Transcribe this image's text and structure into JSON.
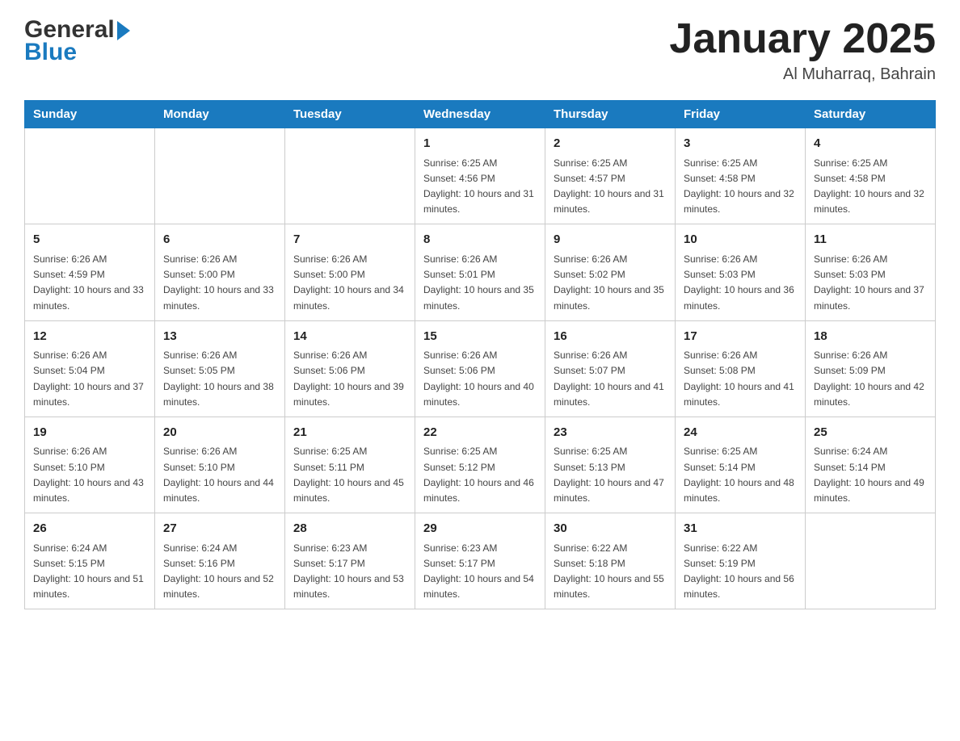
{
  "header": {
    "logo_general": "General",
    "logo_blue": "Blue",
    "month_title": "January 2025",
    "subtitle": "Al Muharraq, Bahrain"
  },
  "weekdays": [
    "Sunday",
    "Monday",
    "Tuesday",
    "Wednesday",
    "Thursday",
    "Friday",
    "Saturday"
  ],
  "weeks": [
    [
      {
        "day": "",
        "sunrise": "",
        "sunset": "",
        "daylight": ""
      },
      {
        "day": "",
        "sunrise": "",
        "sunset": "",
        "daylight": ""
      },
      {
        "day": "",
        "sunrise": "",
        "sunset": "",
        "daylight": ""
      },
      {
        "day": "1",
        "sunrise": "Sunrise: 6:25 AM",
        "sunset": "Sunset: 4:56 PM",
        "daylight": "Daylight: 10 hours and 31 minutes."
      },
      {
        "day": "2",
        "sunrise": "Sunrise: 6:25 AM",
        "sunset": "Sunset: 4:57 PM",
        "daylight": "Daylight: 10 hours and 31 minutes."
      },
      {
        "day": "3",
        "sunrise": "Sunrise: 6:25 AM",
        "sunset": "Sunset: 4:58 PM",
        "daylight": "Daylight: 10 hours and 32 minutes."
      },
      {
        "day": "4",
        "sunrise": "Sunrise: 6:25 AM",
        "sunset": "Sunset: 4:58 PM",
        "daylight": "Daylight: 10 hours and 32 minutes."
      }
    ],
    [
      {
        "day": "5",
        "sunrise": "Sunrise: 6:26 AM",
        "sunset": "Sunset: 4:59 PM",
        "daylight": "Daylight: 10 hours and 33 minutes."
      },
      {
        "day": "6",
        "sunrise": "Sunrise: 6:26 AM",
        "sunset": "Sunset: 5:00 PM",
        "daylight": "Daylight: 10 hours and 33 minutes."
      },
      {
        "day": "7",
        "sunrise": "Sunrise: 6:26 AM",
        "sunset": "Sunset: 5:00 PM",
        "daylight": "Daylight: 10 hours and 34 minutes."
      },
      {
        "day": "8",
        "sunrise": "Sunrise: 6:26 AM",
        "sunset": "Sunset: 5:01 PM",
        "daylight": "Daylight: 10 hours and 35 minutes."
      },
      {
        "day": "9",
        "sunrise": "Sunrise: 6:26 AM",
        "sunset": "Sunset: 5:02 PM",
        "daylight": "Daylight: 10 hours and 35 minutes."
      },
      {
        "day": "10",
        "sunrise": "Sunrise: 6:26 AM",
        "sunset": "Sunset: 5:03 PM",
        "daylight": "Daylight: 10 hours and 36 minutes."
      },
      {
        "day": "11",
        "sunrise": "Sunrise: 6:26 AM",
        "sunset": "Sunset: 5:03 PM",
        "daylight": "Daylight: 10 hours and 37 minutes."
      }
    ],
    [
      {
        "day": "12",
        "sunrise": "Sunrise: 6:26 AM",
        "sunset": "Sunset: 5:04 PM",
        "daylight": "Daylight: 10 hours and 37 minutes."
      },
      {
        "day": "13",
        "sunrise": "Sunrise: 6:26 AM",
        "sunset": "Sunset: 5:05 PM",
        "daylight": "Daylight: 10 hours and 38 minutes."
      },
      {
        "day": "14",
        "sunrise": "Sunrise: 6:26 AM",
        "sunset": "Sunset: 5:06 PM",
        "daylight": "Daylight: 10 hours and 39 minutes."
      },
      {
        "day": "15",
        "sunrise": "Sunrise: 6:26 AM",
        "sunset": "Sunset: 5:06 PM",
        "daylight": "Daylight: 10 hours and 40 minutes."
      },
      {
        "day": "16",
        "sunrise": "Sunrise: 6:26 AM",
        "sunset": "Sunset: 5:07 PM",
        "daylight": "Daylight: 10 hours and 41 minutes."
      },
      {
        "day": "17",
        "sunrise": "Sunrise: 6:26 AM",
        "sunset": "Sunset: 5:08 PM",
        "daylight": "Daylight: 10 hours and 41 minutes."
      },
      {
        "day": "18",
        "sunrise": "Sunrise: 6:26 AM",
        "sunset": "Sunset: 5:09 PM",
        "daylight": "Daylight: 10 hours and 42 minutes."
      }
    ],
    [
      {
        "day": "19",
        "sunrise": "Sunrise: 6:26 AM",
        "sunset": "Sunset: 5:10 PM",
        "daylight": "Daylight: 10 hours and 43 minutes."
      },
      {
        "day": "20",
        "sunrise": "Sunrise: 6:26 AM",
        "sunset": "Sunset: 5:10 PM",
        "daylight": "Daylight: 10 hours and 44 minutes."
      },
      {
        "day": "21",
        "sunrise": "Sunrise: 6:25 AM",
        "sunset": "Sunset: 5:11 PM",
        "daylight": "Daylight: 10 hours and 45 minutes."
      },
      {
        "day": "22",
        "sunrise": "Sunrise: 6:25 AM",
        "sunset": "Sunset: 5:12 PM",
        "daylight": "Daylight: 10 hours and 46 minutes."
      },
      {
        "day": "23",
        "sunrise": "Sunrise: 6:25 AM",
        "sunset": "Sunset: 5:13 PM",
        "daylight": "Daylight: 10 hours and 47 minutes."
      },
      {
        "day": "24",
        "sunrise": "Sunrise: 6:25 AM",
        "sunset": "Sunset: 5:14 PM",
        "daylight": "Daylight: 10 hours and 48 minutes."
      },
      {
        "day": "25",
        "sunrise": "Sunrise: 6:24 AM",
        "sunset": "Sunset: 5:14 PM",
        "daylight": "Daylight: 10 hours and 49 minutes."
      }
    ],
    [
      {
        "day": "26",
        "sunrise": "Sunrise: 6:24 AM",
        "sunset": "Sunset: 5:15 PM",
        "daylight": "Daylight: 10 hours and 51 minutes."
      },
      {
        "day": "27",
        "sunrise": "Sunrise: 6:24 AM",
        "sunset": "Sunset: 5:16 PM",
        "daylight": "Daylight: 10 hours and 52 minutes."
      },
      {
        "day": "28",
        "sunrise": "Sunrise: 6:23 AM",
        "sunset": "Sunset: 5:17 PM",
        "daylight": "Daylight: 10 hours and 53 minutes."
      },
      {
        "day": "29",
        "sunrise": "Sunrise: 6:23 AM",
        "sunset": "Sunset: 5:17 PM",
        "daylight": "Daylight: 10 hours and 54 minutes."
      },
      {
        "day": "30",
        "sunrise": "Sunrise: 6:22 AM",
        "sunset": "Sunset: 5:18 PM",
        "daylight": "Daylight: 10 hours and 55 minutes."
      },
      {
        "day": "31",
        "sunrise": "Sunrise: 6:22 AM",
        "sunset": "Sunset: 5:19 PM",
        "daylight": "Daylight: 10 hours and 56 minutes."
      },
      {
        "day": "",
        "sunrise": "",
        "sunset": "",
        "daylight": ""
      }
    ]
  ]
}
